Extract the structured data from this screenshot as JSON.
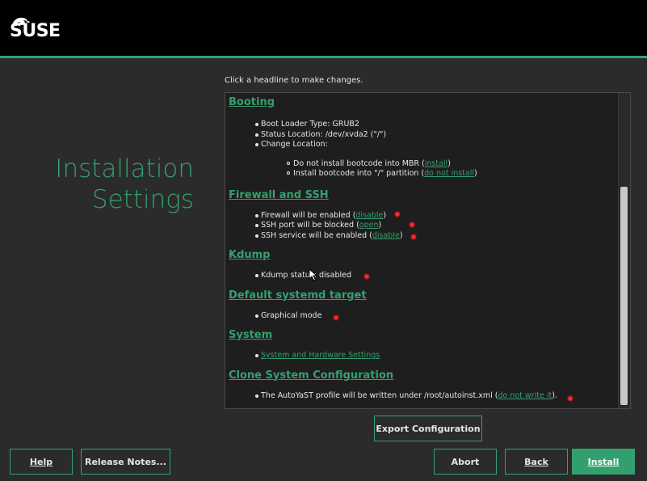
{
  "brand": {
    "logo_text": "SUSE"
  },
  "page": {
    "title_line1": "Installation",
    "title_line2": "Settings",
    "hint": "Click a headline to make changes."
  },
  "colors": {
    "accent": "#34a06f",
    "background": "#2b2b2b",
    "panel": "#1e1e1e",
    "topbar": "#000000"
  },
  "sections": {
    "booting": {
      "title": "Booting",
      "items": [
        "Boot Loader Type: GRUB2",
        "Status Location: /dev/xvda2 (\"/\")",
        "Change Location:"
      ],
      "sub_items": [
        {
          "text": "Do not install bootcode into MBR (",
          "link": "install",
          "tail": ")"
        },
        {
          "text": "Install bootcode into \"/\" partition (",
          "link": "do not install",
          "tail": ")"
        }
      ]
    },
    "firewall": {
      "title": "Firewall and SSH",
      "items": [
        {
          "text": "Firewall will be enabled (",
          "link": "disable",
          "tail": ")"
        },
        {
          "text": "SSH port will be blocked (",
          "link": "open",
          "tail": ")"
        },
        {
          "text": "SSH service will be enabled (",
          "link": "disable",
          "tail": ")"
        }
      ]
    },
    "kdump": {
      "title": "Kdump",
      "items": [
        "Kdump status: disabled"
      ]
    },
    "systemd": {
      "title": "Default systemd target",
      "items": [
        "Graphical mode"
      ]
    },
    "system": {
      "title": "System",
      "link": "System and Hardware Settings"
    },
    "clone": {
      "title": "Clone System Configuration",
      "text": "The AutoYaST profile will be written under /root/autoinst.xml (",
      "link": "do not write it",
      "tail": ")."
    }
  },
  "buttons": {
    "export": "Export Configuration",
    "help": "Help",
    "release_notes": "Release Notes...",
    "abort": "Abort",
    "back": "Back",
    "install": "Install"
  }
}
